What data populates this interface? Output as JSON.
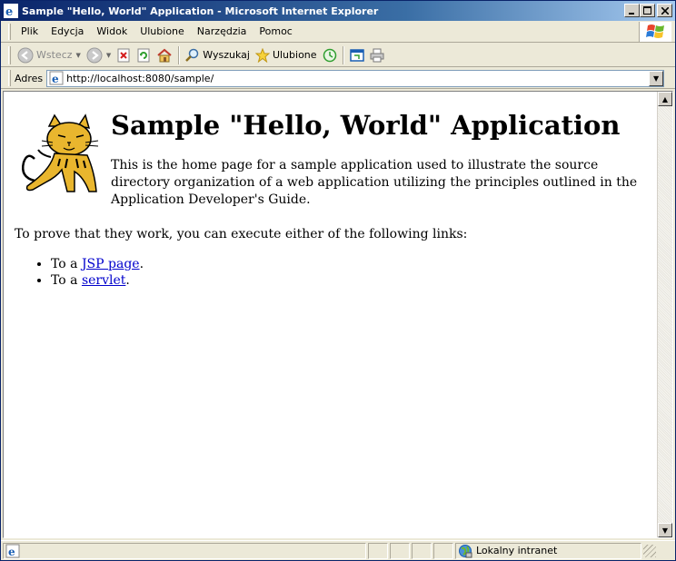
{
  "window": {
    "title": "Sample \"Hello, World\" Application - Microsoft Internet Explorer",
    "controls": {
      "minimize": "_",
      "maximize": "□",
      "close": "×"
    }
  },
  "menubar": {
    "items": [
      {
        "label": "Plik"
      },
      {
        "label": "Edycja"
      },
      {
        "label": "Widok"
      },
      {
        "label": "Ulubione"
      },
      {
        "label": "Narzędzia"
      },
      {
        "label": "Pomoc"
      }
    ]
  },
  "toolbar": {
    "back_label": "Wstecz",
    "search_label": "Wyszukaj",
    "favorites_label": "Ulubione"
  },
  "address": {
    "label": "Adres",
    "url": "http://localhost:8080/sample/"
  },
  "page": {
    "heading": "Sample \"Hello, World\" Application",
    "intro": "This is the home page for a sample application used to illustrate the source directory organization of a web application utilizing the principles outlined in the Application Developer's Guide.",
    "prove_text": "To prove that they work, you can execute either of the following links:",
    "links": [
      {
        "prefix": "To a ",
        "link_text": "JSP page",
        "suffix": "."
      },
      {
        "prefix": "To a ",
        "link_text": "servlet",
        "suffix": "."
      }
    ]
  },
  "statusbar": {
    "zone_label": "Lokalny intranet"
  },
  "colors": {
    "titlebar_start": "#0a246a",
    "titlebar_end": "#a6caf0",
    "link": "#0000cc",
    "chrome": "#ece9d8"
  }
}
